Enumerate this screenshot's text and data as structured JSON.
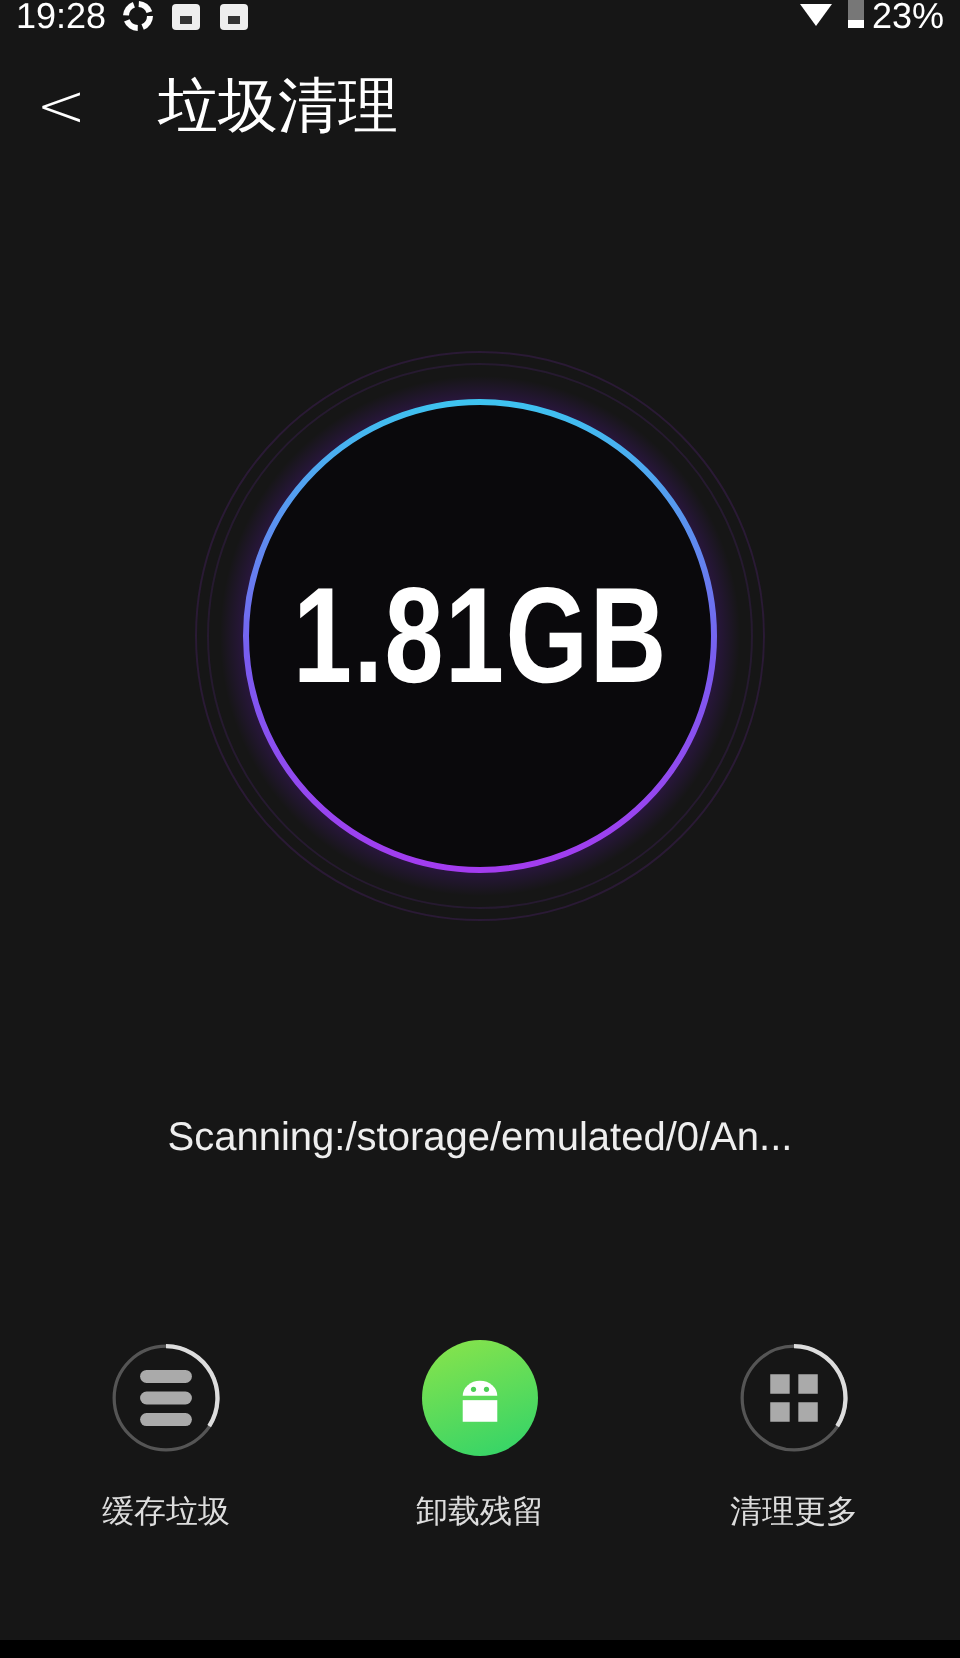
{
  "status_bar": {
    "time": "19:28",
    "battery": "23%"
  },
  "header": {
    "back": "<",
    "title": "垃圾清理"
  },
  "scan": {
    "size": "1.81GB",
    "path": "Scanning:/storage/emulated/0/An..."
  },
  "categories": [
    {
      "kind": "cache",
      "label": "缓存垃圾",
      "selected": false
    },
    {
      "kind": "uninstall",
      "label": "卸载残留",
      "selected": true
    },
    {
      "kind": "more",
      "label": "清理更多",
      "selected": false
    }
  ]
}
